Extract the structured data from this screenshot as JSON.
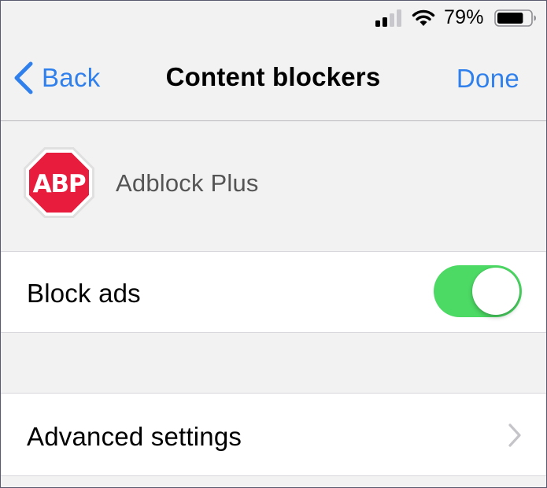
{
  "status_bar": {
    "battery_percent": "79%",
    "battery_level": 0.79,
    "signal_bars_active": 2,
    "signal_bars_total": 4
  },
  "nav": {
    "back_label": "Back",
    "title": "Content blockers",
    "done_label": "Done"
  },
  "app": {
    "logo_text": "ABP",
    "name": "Adblock Plus"
  },
  "settings": {
    "block_ads_label": "Block ads",
    "block_ads_enabled": true,
    "advanced_label": "Advanced settings"
  },
  "colors": {
    "accent": "#2f80ed",
    "toggle_on": "#4cd964",
    "abp_red": "#e81c3c",
    "background": "#f2f2f2"
  },
  "icons": {
    "back": "chevron-left-icon",
    "row_disclosure": "chevron-right-icon",
    "signal": "cellular-signal-icon",
    "wifi": "wifi-icon",
    "battery": "battery-icon"
  }
}
